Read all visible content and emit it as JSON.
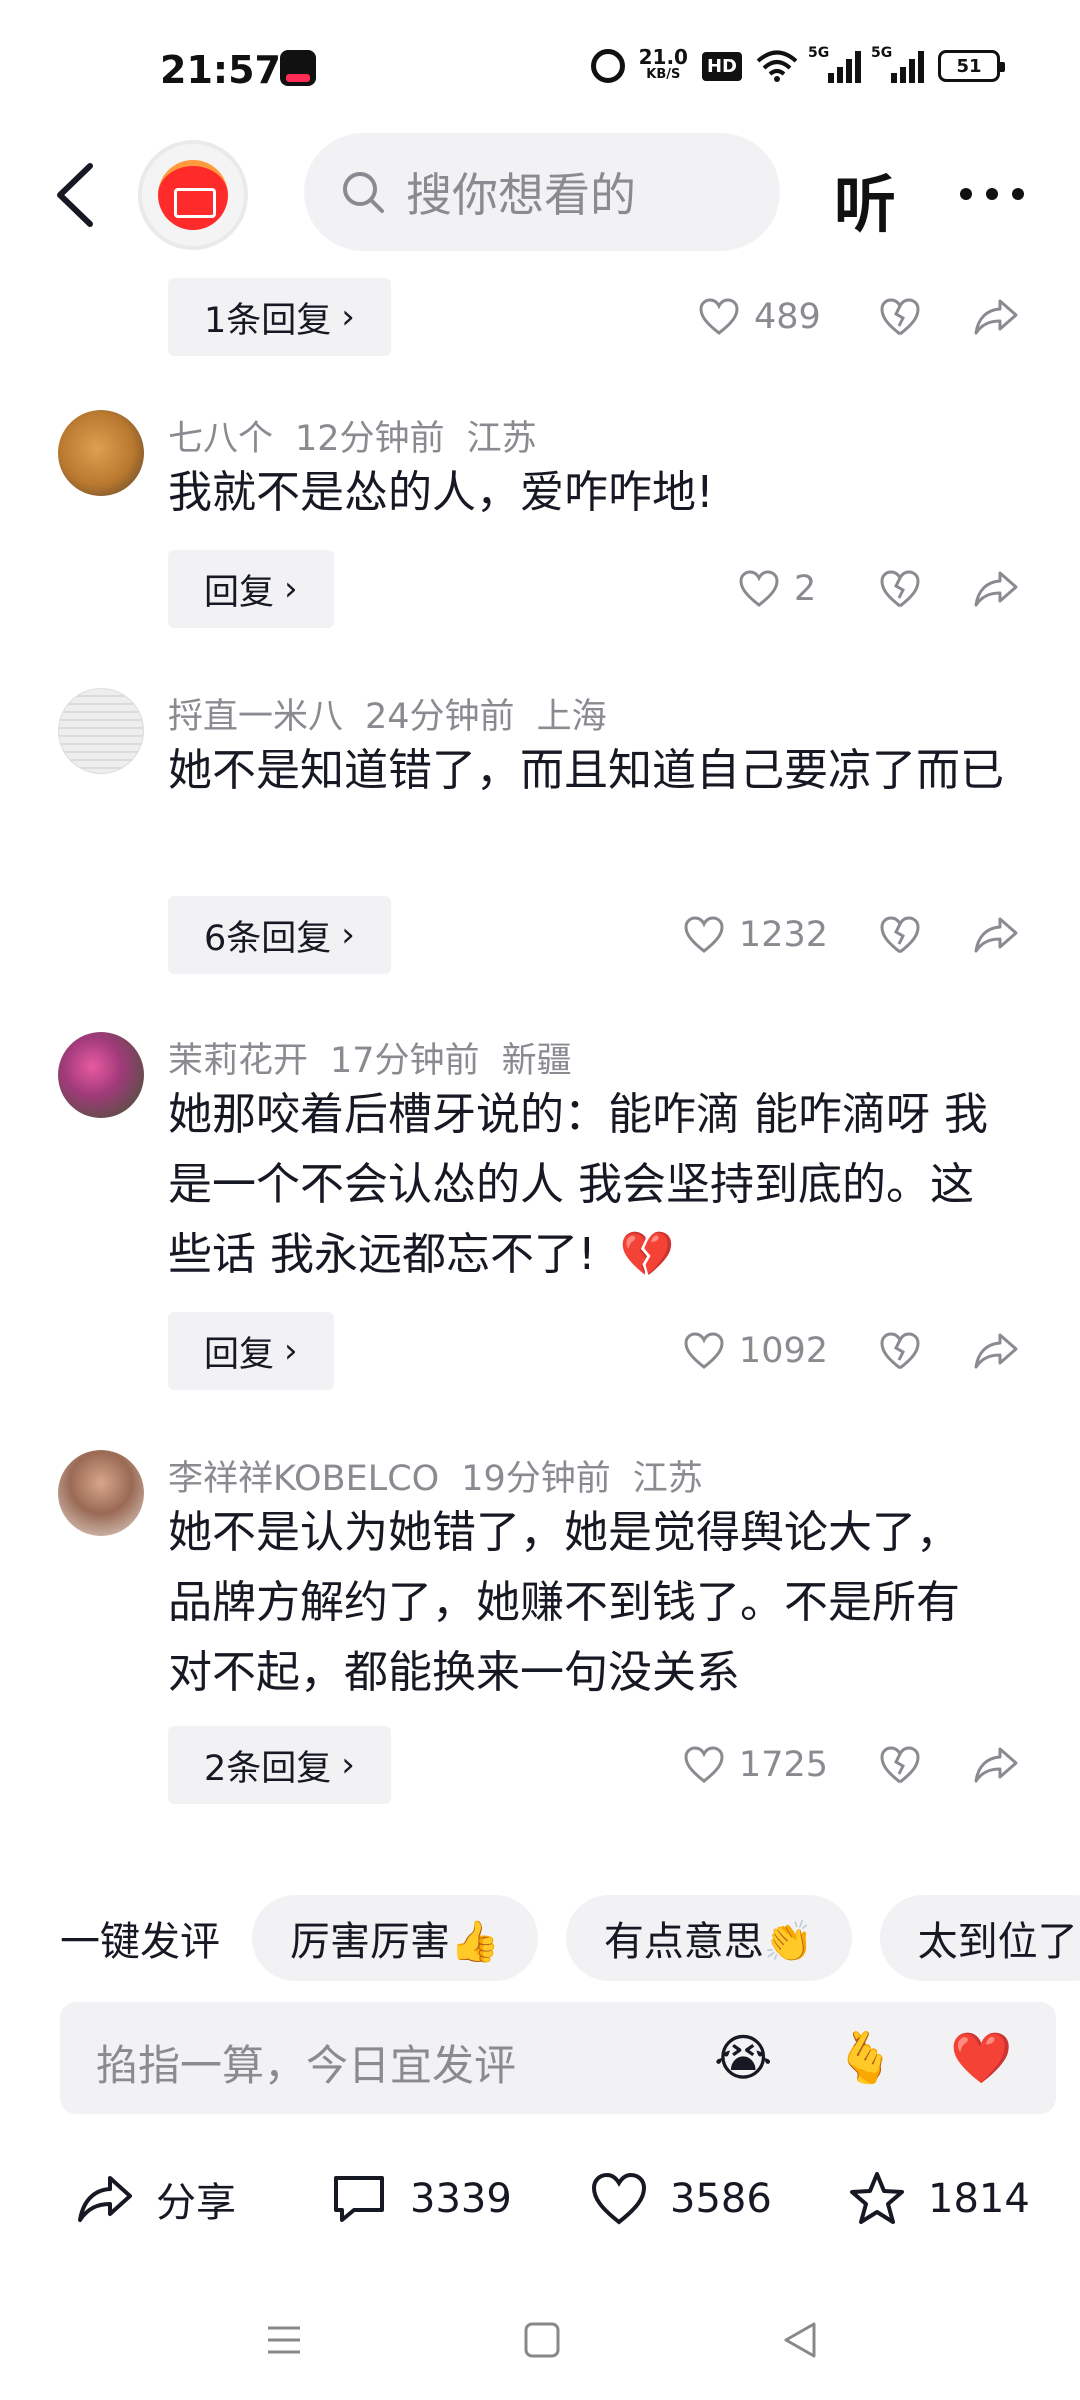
{
  "status_bar": {
    "time": "21:57",
    "speed_value": "21.0",
    "speed_unit": "KB/S",
    "hd": "HD",
    "net1": "5G",
    "net2": "5G",
    "battery": "51"
  },
  "header": {
    "search_placeholder": "搜你想看的",
    "listen_label": "听"
  },
  "comments": [
    {
      "reply_label": "1条回复",
      "likes": "489"
    },
    {
      "user": "七八个",
      "time": "12分钟前",
      "location": "江苏",
      "text": "我就不是怂的人，爱咋咋地!",
      "reply_label": "回复",
      "likes": "2",
      "avatar_color": "#b8782f"
    },
    {
      "user": "捋直一米八",
      "time": "24分钟前",
      "location": "上海",
      "text": "她不是知道错了，而且知道自己要凉了而已",
      "reply_label": "6条回复",
      "likes": "1232",
      "avatar_color": "#e6e6e6"
    },
    {
      "user": "茉莉花开",
      "time": "17分钟前",
      "location": "新疆",
      "text": "她那咬着后槽牙说的：能咋滴 能咋滴呀 我是一个不会认怂的人 我会坚持到底的。这些话 我永远都忘不了!",
      "text_emoji": "💔",
      "reply_label": "回复",
      "likes": "1092",
      "avatar_color": "#7a3a6a"
    },
    {
      "user": "李祥祥KOBELCO",
      "time": "19分钟前",
      "location": "江苏",
      "text": "她不是认为她错了，她是觉得舆论大了，品牌方解约了，她赚不到钱了。不是所有对不起，都能换来一句没关系",
      "reply_label": "2条回复",
      "likes": "1725",
      "avatar_color": "#9a6a55"
    }
  ],
  "quick_comment": {
    "label": "一键发评",
    "chips": [
      "厉害厉害👍",
      "有点意思👏",
      "太到位了"
    ]
  },
  "input": {
    "placeholder": "掐指一算，今日宜发评",
    "emojis": [
      "😭",
      "🫰",
      "❤️"
    ]
  },
  "bottom_bar": {
    "share_label": "分享",
    "comment_count": "3339",
    "like_count": "3586",
    "favorite_count": "1814"
  },
  "colors": {
    "accent_red": "#fe2c55",
    "muted_text": "#8a8b91",
    "chip_bg": "#f2f2f4"
  }
}
